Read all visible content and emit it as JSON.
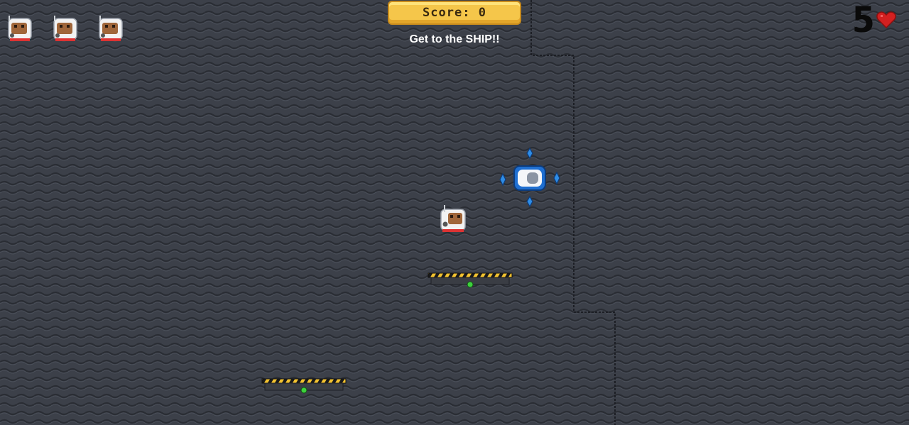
{
  "hud": {
    "score_label": "Score:",
    "score_value": "0",
    "message": "Get to the SHIP!!",
    "health_value": "5",
    "lives_remaining": 3
  },
  "icons": {
    "life": "astronaut-icon",
    "health": "heart-icon",
    "goal": "ship-icon",
    "player": "astronaut-player"
  },
  "colors": {
    "background": "#3c4049",
    "score_box": "#f5c64a",
    "heart": "#d32020",
    "ship_glow": "#2f8de6",
    "platform_stripe": "#f2c230",
    "platform_light": "#3dd13d"
  }
}
